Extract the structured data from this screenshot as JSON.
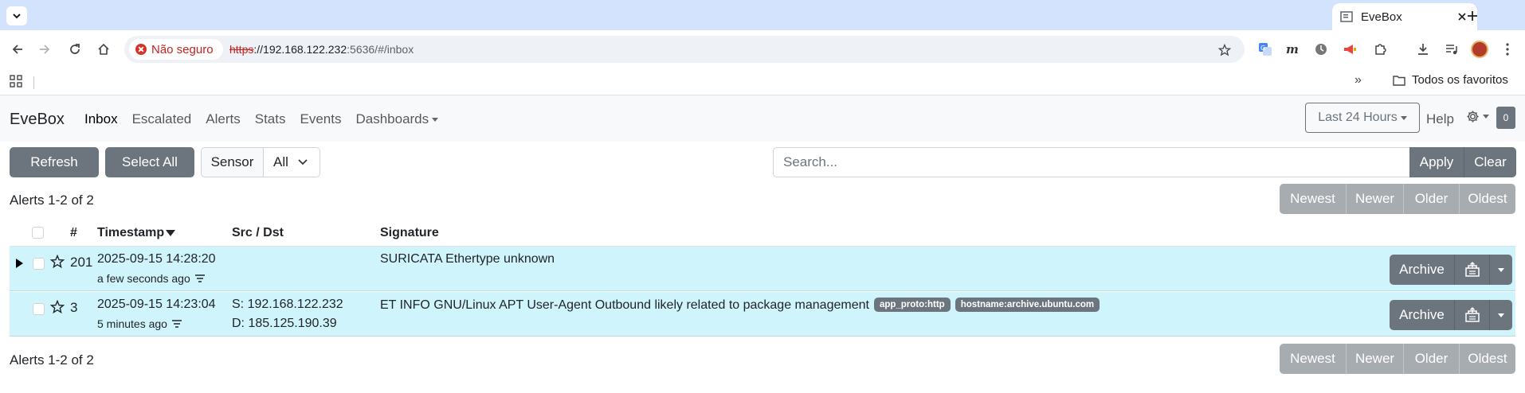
{
  "browser": {
    "tab_title": "EveBox",
    "security_label": "Não seguro",
    "url_scheme": "https",
    "url_host": "://192.168.122.232",
    "url_path": ":5636/#/inbox",
    "bookmarks_more": "»",
    "bookmarks_folder": "Todos os favoritos"
  },
  "app": {
    "brand": "EveBox",
    "nav": [
      "Inbox",
      "Escalated",
      "Alerts",
      "Stats",
      "Events",
      "Dashboards"
    ],
    "time_range": "Last 24 Hours",
    "help": "Help",
    "badge_count": "0"
  },
  "controls": {
    "refresh": "Refresh",
    "select_all": "Select All",
    "sensor_label": "Sensor",
    "sensor_value": "All",
    "search_placeholder": "Search...",
    "apply": "Apply",
    "clear": "Clear"
  },
  "pager": {
    "summary": "Alerts 1-2 of 2",
    "newest": "Newest",
    "newer": "Newer",
    "older": "Older",
    "oldest": "Oldest"
  },
  "table": {
    "headers": {
      "count": "#",
      "timestamp": "Timestamp",
      "src_dst": "Src / Dst",
      "signature": "Signature"
    },
    "rows": [
      {
        "count": "201",
        "timestamp": "2025-09-15 14:28:20",
        "ago": "a few seconds ago",
        "src": "",
        "dst": "",
        "signature": "SURICATA Ethertype unknown",
        "tags": []
      },
      {
        "count": "3",
        "timestamp": "2025-09-15 14:23:04",
        "ago": "5 minutes ago",
        "src": "S: 192.168.122.232",
        "dst": "D: 185.125.190.39",
        "signature": "ET INFO GNU/Linux APT User-Agent Outbound likely related to package management",
        "tags": [
          "app_proto:http",
          "hostname:archive.ubuntu.com"
        ]
      }
    ],
    "archive_label": "Archive"
  },
  "colors": {
    "row_bg": "#cff4fc",
    "secondary": "#6c757d",
    "insecure": "#d93025",
    "tabbar": "#d3e3fd"
  }
}
